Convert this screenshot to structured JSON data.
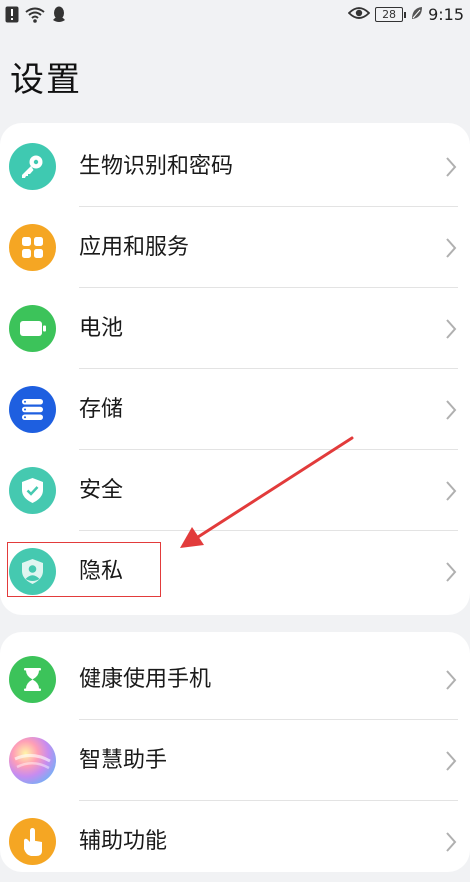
{
  "status_bar": {
    "time": "9:15",
    "battery": "28",
    "icons": [
      "alert-icon",
      "wifi-icon",
      "qq-icon",
      "eye-icon",
      "battery-icon",
      "leaf-icon"
    ]
  },
  "page": {
    "title": "设置"
  },
  "settings": {
    "group1": [
      {
        "label": "生物识别和密码",
        "icon": "key-icon",
        "color": "#3fc9b1"
      },
      {
        "label": "应用和服务",
        "icon": "apps-grid-icon",
        "color": "#f5a623"
      },
      {
        "label": "电池",
        "icon": "battery-icon",
        "color": "#3cc35a"
      },
      {
        "label": "存储",
        "icon": "storage-icon",
        "color": "#1e5fe0"
      },
      {
        "label": "安全",
        "icon": "shield-check-icon",
        "color": "#45c9b0"
      },
      {
        "label": "隐私",
        "icon": "privacy-shield-icon",
        "color": "#45c9b0"
      }
    ],
    "group2": [
      {
        "label": "健康使用手机",
        "icon": "hourglass-icon",
        "color": "#3cc35a"
      },
      {
        "label": "智慧助手",
        "icon": "assistant-orb-icon",
        "color": "#e46fb3"
      },
      {
        "label": "辅助功能",
        "icon": "hand-icon",
        "color": "#f5a623"
      }
    ]
  },
  "annotation": {
    "highlight_color": "#e23b3b"
  }
}
